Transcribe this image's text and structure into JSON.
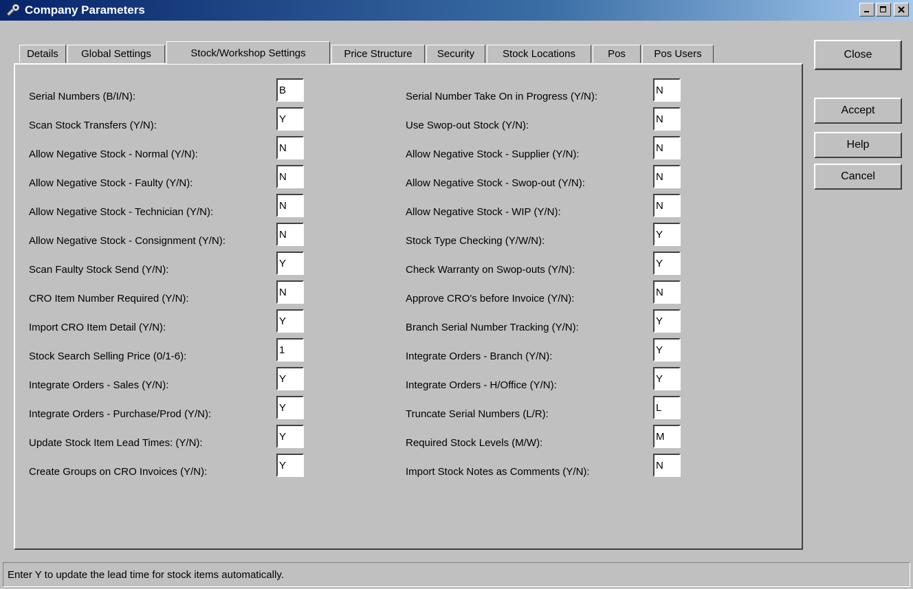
{
  "window": {
    "title": "Company Parameters"
  },
  "tabs": [
    {
      "label": "Details"
    },
    {
      "label": "Global Settings"
    },
    {
      "label": "Stock/Workshop Settings"
    },
    {
      "label": "Price Structure"
    },
    {
      "label": "Security"
    },
    {
      "label": "Stock Locations"
    },
    {
      "label": "Pos"
    },
    {
      "label": "Pos Users"
    }
  ],
  "left_fields": [
    {
      "label": "Serial Numbers (B/I/N):",
      "value": "B"
    },
    {
      "label": "Scan Stock Transfers (Y/N):",
      "value": "Y"
    },
    {
      "label": "Allow Negative Stock - Normal (Y/N):",
      "value": "N"
    },
    {
      "label": "Allow Negative Stock - Faulty (Y/N):",
      "value": "N"
    },
    {
      "label": "Allow Negative Stock - Technician (Y/N):",
      "value": "N"
    },
    {
      "label": "Allow Negative Stock - Consignment (Y/N):",
      "value": "N"
    },
    {
      "label": "Scan Faulty Stock Send (Y/N):",
      "value": "Y"
    },
    {
      "label": "CRO Item Number Required (Y/N):",
      "value": "N"
    },
    {
      "label": "Import CRO Item Detail (Y/N):",
      "value": "Y"
    },
    {
      "label": "Stock Search Selling Price (0/1-6):",
      "value": "1"
    },
    {
      "label": "Integrate Orders - Sales (Y/N):",
      "value": "Y"
    },
    {
      "label": "Integrate Orders - Purchase/Prod (Y/N):",
      "value": "Y"
    },
    {
      "label": "Update Stock Item Lead Times: (Y/N):",
      "value": "Y"
    },
    {
      "label": "Create Groups on CRO Invoices (Y/N):",
      "value": "Y"
    }
  ],
  "right_fields": [
    {
      "label": "Serial Number Take On in Progress (Y/N):",
      "value": "N"
    },
    {
      "label": "Use Swop-out Stock (Y/N):",
      "value": "N"
    },
    {
      "label": "Allow Negative Stock - Supplier (Y/N):",
      "value": "N"
    },
    {
      "label": "Allow Negative Stock - Swop-out (Y/N):",
      "value": "N"
    },
    {
      "label": "Allow Negative Stock - WIP (Y/N):",
      "value": "N"
    },
    {
      "label": "Stock Type Checking (Y/W/N):",
      "value": "Y"
    },
    {
      "label": "Check Warranty on Swop-outs (Y/N):",
      "value": "Y"
    },
    {
      "label": "Approve CRO's before Invoice (Y/N):",
      "value": "N"
    },
    {
      "label": "Branch Serial Number Tracking (Y/N):",
      "value": "Y"
    },
    {
      "label": "Integrate Orders - Branch (Y/N):",
      "value": "Y"
    },
    {
      "label": "Integrate Orders - H/Office (Y/N):",
      "value": "Y"
    },
    {
      "label": "Truncate Serial Numbers (L/R):",
      "value": "L"
    },
    {
      "label": "Required Stock Levels (M/W):",
      "value": "M"
    },
    {
      "label": "Import Stock Notes as Comments (Y/N):",
      "value": "N"
    }
  ],
  "buttons": [
    {
      "label": "Close"
    },
    {
      "label": "Accept"
    },
    {
      "label": "Help"
    },
    {
      "label": "Cancel"
    }
  ],
  "status_bar": {
    "text": "Enter Y to update the lead time for stock items automatically."
  },
  "colors": {
    "title_start": "#08246b",
    "title_end": "#a6caf0",
    "face": "#c0c0c0"
  }
}
